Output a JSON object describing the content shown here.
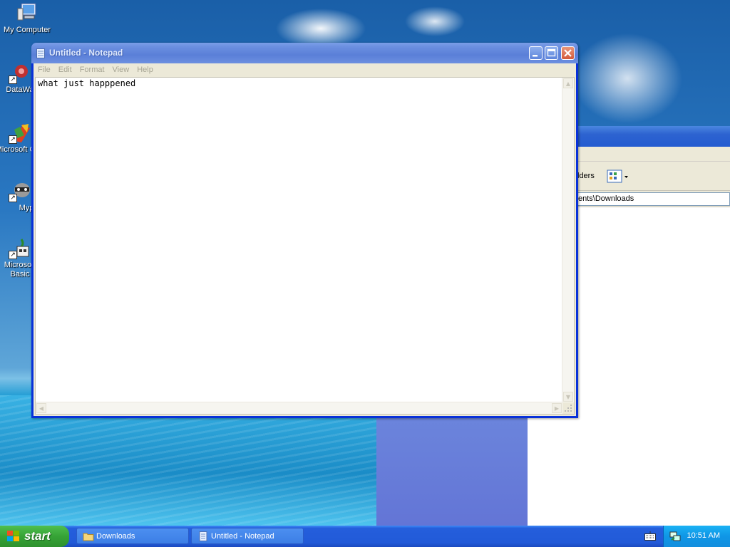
{
  "desktop": {
    "icons": [
      {
        "label": "My Computer",
        "icon": "my-computer-icon"
      },
      {
        "label": "DataWa",
        "icon": "datawarehouse-icon"
      },
      {
        "label": "Microsoft C++",
        "icon": "msvc-icon"
      },
      {
        "label": "Myp",
        "icon": "raccoon-icon"
      },
      {
        "label": "Microsoft Basic",
        "icon": "vb-icon"
      }
    ]
  },
  "explorer": {
    "folders_label": "lders",
    "address": "ents\\Downloads"
  },
  "notepad": {
    "title": "Untitled - Notepad",
    "menu": [
      "File",
      "Edit",
      "Format",
      "View",
      "Help"
    ],
    "content": "what just happpened",
    "buttons": {
      "minimize": "_",
      "maximize": "□",
      "close": "✕"
    }
  },
  "taskbar": {
    "start_label": "start",
    "tasks": [
      {
        "label": "Downloads",
        "icon": "folder-icon"
      },
      {
        "label": "Untitled - Notepad",
        "icon": "notepad-icon"
      }
    ],
    "clock": "10:51 AM"
  },
  "colors": {
    "title_active": "#0831d9",
    "taskbar": "#245edc",
    "start": "#36a336",
    "tray": "#0f96e6"
  }
}
